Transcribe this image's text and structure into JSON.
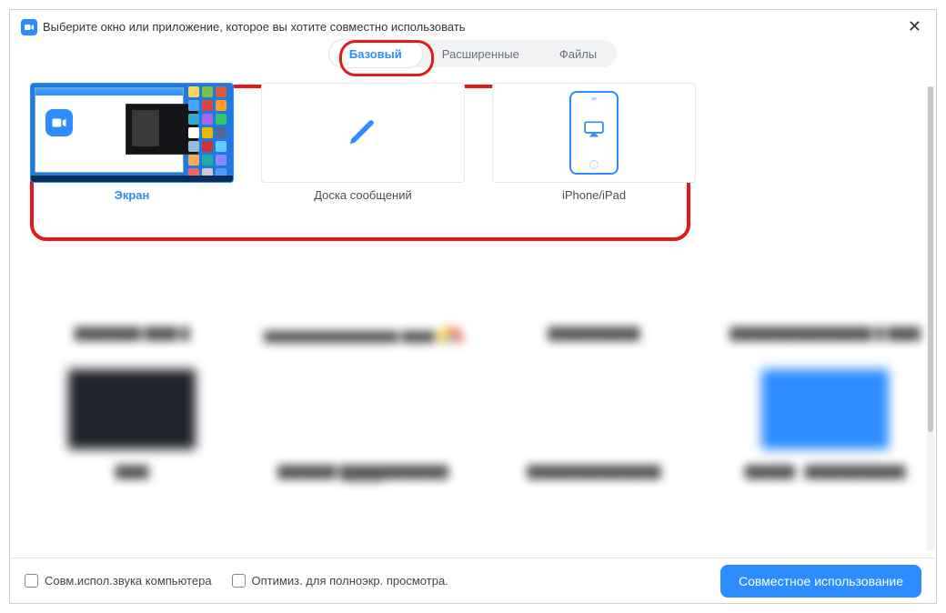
{
  "window": {
    "title": "Выберите окно или приложение, которое вы хотите совместно использовать"
  },
  "tabs": {
    "basic": "Базовый",
    "advanced": "Расширенные",
    "files": "Файлы"
  },
  "tiles": {
    "screen": "Экран",
    "whiteboard": "Доска сообщений",
    "iphone": "iPhone/iPad"
  },
  "footer": {
    "share_audio": "Совм.испол.звука компьютера",
    "optimize_video": "Оптимиз. для полноэкр. просмотра.",
    "share_button": "Совместное использование"
  },
  "colors": {
    "accent": "#2d8cff",
    "highlight": "#e21a1a"
  }
}
